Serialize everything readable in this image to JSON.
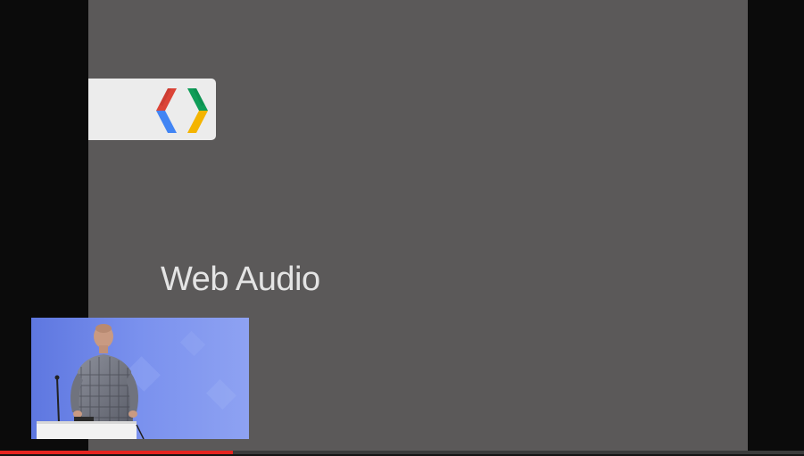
{
  "slide": {
    "title": "Web Audio",
    "logo_icon": "chrome-devtools-logo-icon",
    "logo_colors": {
      "red": "#db4437",
      "blue": "#4285f4",
      "green": "#0f9d58",
      "yellow": "#f4b400"
    }
  },
  "video": {
    "progress_fraction": 0.29,
    "progress_color": "#e52420"
  },
  "inset": {
    "description_icon": "speaker-video-icon"
  }
}
